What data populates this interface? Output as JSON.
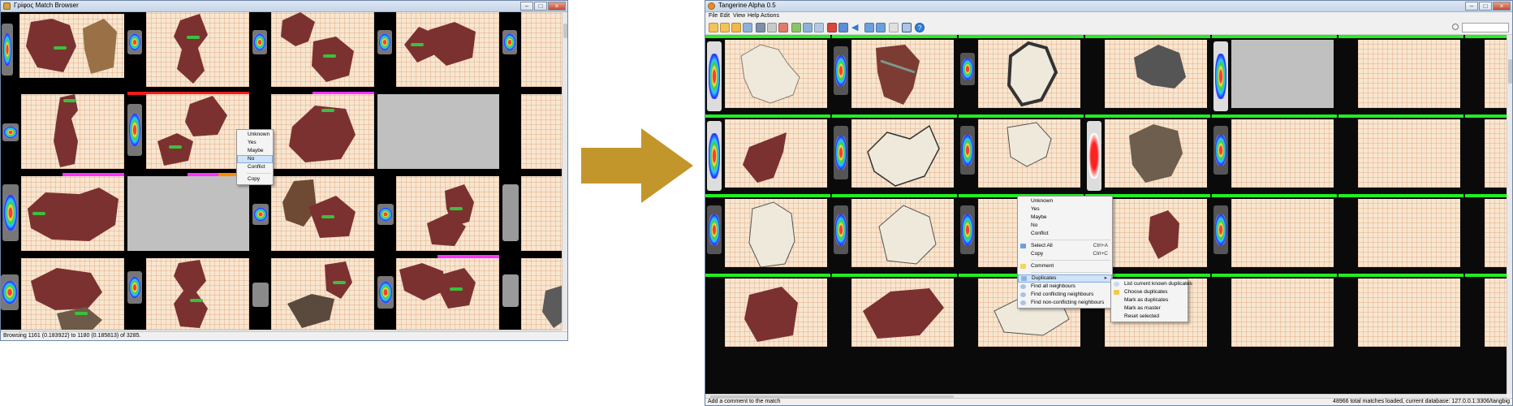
{
  "left_window": {
    "title": "Γρίφος Match Browser",
    "status": "Browsing 1161 (0.183922) to 1180 (0.185813) of 3285.",
    "context_menu": [
      "Unknown",
      "Yes",
      "Maybe",
      "No",
      "Conflict",
      "Copy"
    ],
    "highlighted_item": "No"
  },
  "right_window": {
    "title": "Tangerine Alpha 0.5",
    "menu": [
      "File",
      "Edit",
      "View",
      "Help",
      "Actions"
    ],
    "status_left": "Add a comment to the match",
    "status_right": "48966 total matches loaded, current database: 127.0.0.1:3306/tangbig",
    "context_menu": {
      "group1": [
        "Unknown",
        "Yes",
        "Maybe",
        "No",
        "Conflict"
      ],
      "select_all": {
        "label": "Select All",
        "shortcut": "Ctrl+A"
      },
      "copy": {
        "label": "Copy",
        "shortcut": "Ctrl+C"
      },
      "comment": "Comment",
      "duplicates": "Duplicates",
      "neighbours": [
        "Find all neighbours",
        "Find conflicting neighbours",
        "Find non-conflicting neighbours"
      ]
    },
    "submenu": [
      "List current known duplicates",
      "Choose duplicates",
      "Mark as duplicates",
      "Mark as master",
      "Reset selected"
    ]
  },
  "colors": {
    "arrow": "#c2962a",
    "green_bar": "#22ee22",
    "magenta_bar": "#ff33ff",
    "red_bar": "#ee1c1c",
    "orange_bar": "#ff8c00",
    "fragment_red": "#7c3131",
    "fragment_white": "#efe9dc"
  }
}
